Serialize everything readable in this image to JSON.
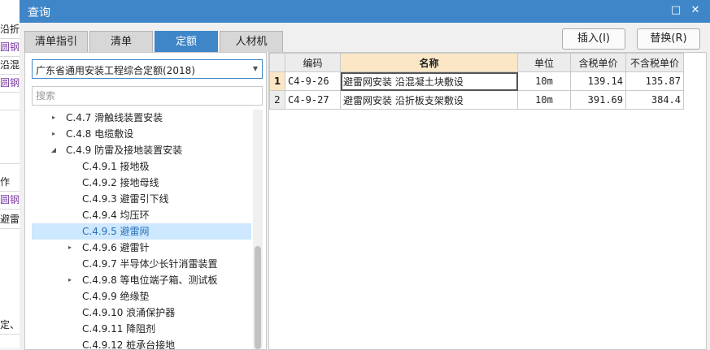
{
  "background_app": {
    "rows": [
      "沿折",
      "圆钢",
      "沿混",
      "圆钢",
      "",
      "",
      "作",
      "圆钢",
      "避雷",
      "",
      "",
      "",
      "",
      "定、"
    ]
  },
  "dialog": {
    "title": "查询",
    "controls": {
      "restore": "□",
      "close": "✕"
    }
  },
  "tabs": [
    "清单指引",
    "清单",
    "定额",
    "人材机"
  ],
  "active_tab": "定额",
  "actions": {
    "insert": "插入(I)",
    "replace": "替换(R)"
  },
  "quota_library": "广东省通用安装工程综合定额(2018)",
  "search": {
    "placeholder": "搜索",
    "value": ""
  },
  "tree": [
    {
      "label": "C.4.7 滑触线装置安装",
      "level": 1,
      "arrow": "▸"
    },
    {
      "label": "C.4.8 电缆敷设",
      "level": 1,
      "arrow": "▸"
    },
    {
      "label": "C.4.9 防雷及接地装置安装",
      "level": 1,
      "arrow": "◢"
    },
    {
      "label": "C.4.9.1 接地极",
      "level": 2,
      "arrow": ""
    },
    {
      "label": "C.4.9.2 接地母线",
      "level": 2,
      "arrow": ""
    },
    {
      "label": "C.4.9.3 避雷引下线",
      "level": 2,
      "arrow": ""
    },
    {
      "label": "C.4.9.4 均压环",
      "level": 2,
      "arrow": ""
    },
    {
      "label": "C.4.9.5 避雷网",
      "level": 2,
      "arrow": "",
      "selected": true
    },
    {
      "label": "C.4.9.6 避雷针",
      "level": 2,
      "arrow": "▸"
    },
    {
      "label": "C.4.9.7 半导体少长针消雷装置",
      "level": 2,
      "arrow": ""
    },
    {
      "label": "C.4.9.8 等电位端子箱、测试板",
      "level": 2,
      "arrow": "▸"
    },
    {
      "label": "C.4.9.9 绝缘垫",
      "level": 2,
      "arrow": ""
    },
    {
      "label": "C.4.9.10 浪涌保护器",
      "level": 2,
      "arrow": ""
    },
    {
      "label": "C.4.9.11 降阻剂",
      "level": 2,
      "arrow": ""
    },
    {
      "label": "C.4.9.12 桩承台接地",
      "level": 2,
      "arrow": ""
    }
  ],
  "table": {
    "headers": {
      "code": "编码",
      "name": "名称",
      "unit": "单位",
      "price_tax": "含税单价",
      "price_notax": "不含税单价"
    },
    "rows": [
      {
        "num": "1",
        "code": "C4-9-26",
        "name": "避雷网安装 沿混凝土块敷设",
        "unit": "10m",
        "price_tax": "139.14",
        "price_notax": "135.87"
      },
      {
        "num": "2",
        "code": "C4-9-27",
        "name": "避雷网安装 沿折板支架敷设",
        "unit": "10m",
        "price_tax": "391.69",
        "price_notax": "384.4"
      }
    ]
  },
  "colors": {
    "titlebar": "#3f86c8",
    "selected_row": "#cde8ff",
    "header_highlight": "#fbe7c6"
  }
}
